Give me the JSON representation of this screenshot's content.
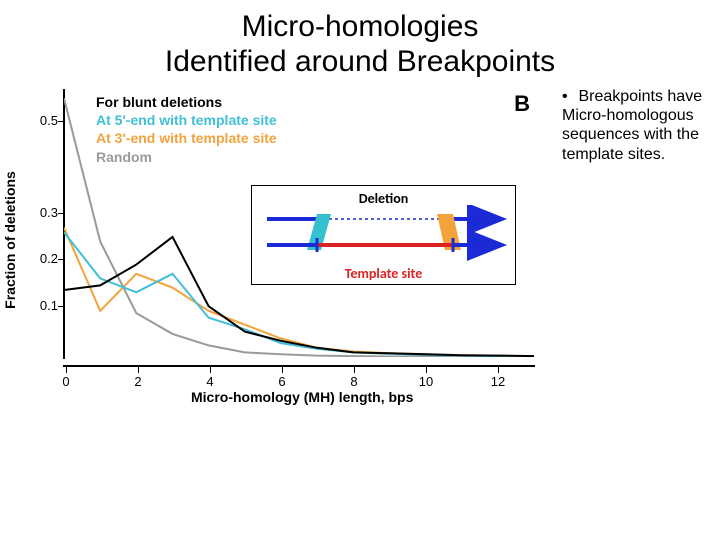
{
  "title_line1": "Micro-homologies",
  "title_line2": "Identified around Breakpoints",
  "bullet_text": "Breakpoints have Micro-homologous sequences with the template sites.",
  "xlabel": "Micro-homology (MH) length, bps",
  "ylabel": "Fraction of deletions",
  "panel_letter": "B",
  "legend": {
    "blunt": "For blunt deletions",
    "five": "At 5'-end with template site",
    "three": "At 3'-end with template site",
    "random": "Random"
  },
  "inset": {
    "deletion_label": "Deletion",
    "template_label": "Template site"
  },
  "chart_data": {
    "type": "line",
    "xlabel": "Micro-homology (MH) length, bps",
    "ylabel": "Fraction of deletions",
    "xlim": [
      0,
      13
    ],
    "ylim": [
      0,
      0.58
    ],
    "xticks": [
      0,
      2,
      4,
      6,
      8,
      10,
      12
    ],
    "yticks": [
      0.1,
      0.2,
      0.3,
      0.5
    ],
    "x": [
      0,
      1,
      2,
      3,
      4,
      5,
      6,
      7,
      8,
      9,
      10,
      11,
      12,
      13
    ],
    "series": [
      {
        "name": "For blunt deletions",
        "color": "#000000",
        "values": [
          0.145,
          0.155,
          0.2,
          0.26,
          0.11,
          0.055,
          0.035,
          0.02,
          0.01,
          0.008,
          0.006,
          0.004,
          0.003,
          0.002
        ]
      },
      {
        "name": "At 5'-end with template site",
        "color": "#3fbfd8",
        "values": [
          0.27,
          0.17,
          0.14,
          0.18,
          0.085,
          0.06,
          0.03,
          0.018,
          0.01,
          0.007,
          0.005,
          0.003,
          0.002,
          0.001
        ]
      },
      {
        "name": "At 3'-end with template site",
        "color": "#f2a33c",
        "values": [
          0.28,
          0.1,
          0.18,
          0.15,
          0.1,
          0.07,
          0.04,
          0.02,
          0.012,
          0.008,
          0.006,
          0.004,
          0.003,
          0.002
        ]
      },
      {
        "name": "Random",
        "color": "#9a9a9a",
        "values": [
          0.56,
          0.25,
          0.095,
          0.05,
          0.025,
          0.01,
          0.006,
          0.003,
          0.002,
          0.001,
          0.001,
          0.001,
          0.0,
          0.0
        ]
      }
    ]
  }
}
